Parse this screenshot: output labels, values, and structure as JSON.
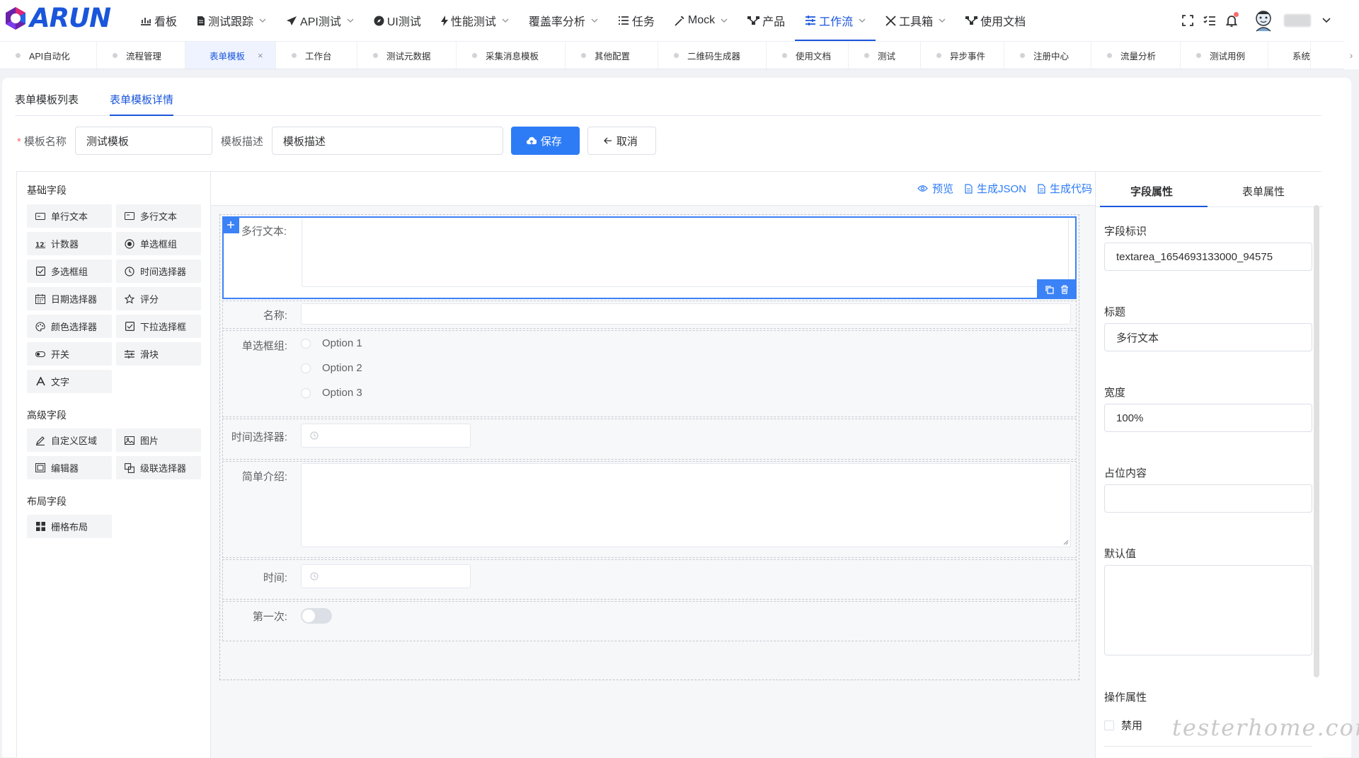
{
  "app": {
    "logo_text": "ARUN"
  },
  "menu": [
    {
      "label": "看板",
      "icon": "chart-icon",
      "dropdown": false
    },
    {
      "label": "测试跟踪",
      "icon": "document-icon",
      "dropdown": true
    },
    {
      "label": "API测试",
      "icon": "send-icon",
      "dropdown": true
    },
    {
      "label": "UI测试",
      "icon": "compass-icon",
      "dropdown": false
    },
    {
      "label": "性能测试",
      "icon": "lightning-icon",
      "dropdown": true
    },
    {
      "label": "覆盖率分析",
      "icon": "",
      "dropdown": true
    },
    {
      "label": "任务",
      "icon": "list-icon",
      "dropdown": false
    },
    {
      "label": "Mock",
      "icon": "wand-icon",
      "dropdown": true
    },
    {
      "label": "产品",
      "icon": "network-icon",
      "dropdown": false
    },
    {
      "label": "工作流",
      "icon": "sliders-icon",
      "dropdown": true,
      "active": true
    },
    {
      "label": "工具箱",
      "icon": "tools-icon",
      "dropdown": true
    },
    {
      "label": "使用文档",
      "icon": "network-icon",
      "dropdown": false
    }
  ],
  "tabs": [
    {
      "label": "API自动化"
    },
    {
      "label": "流程管理"
    },
    {
      "label": "表单模板",
      "active": true,
      "closable": true
    },
    {
      "label": "工作台"
    },
    {
      "label": "测试元数据"
    },
    {
      "label": "采集消息模板"
    },
    {
      "label": "其他配置"
    },
    {
      "label": "二维码生成器"
    },
    {
      "label": "使用文档"
    },
    {
      "label": "测试"
    },
    {
      "label": "异步事件"
    },
    {
      "label": "注册中心"
    },
    {
      "label": "流量分析"
    },
    {
      "label": "测试用例"
    },
    {
      "label": "系统"
    }
  ],
  "tab_close_glyph": "×",
  "subtabs": {
    "list": "表单模板列表",
    "detail": "表单模板详情"
  },
  "form": {
    "name_required_mark": "*",
    "name_label": "模板名称",
    "name_value": "测试模板",
    "desc_label": "模板描述",
    "desc_placeholder": "模板描述",
    "save_label": "保存",
    "cancel_label": "取消"
  },
  "left_panel": {
    "basic_title": "基础字段",
    "basic_fields": [
      {
        "label": "单行文本",
        "icon": "input-icon"
      },
      {
        "label": "多行文本",
        "icon": "textarea-icon"
      },
      {
        "label": "计数器",
        "icon": "counter-icon"
      },
      {
        "label": "单选框组",
        "icon": "radio-icon"
      },
      {
        "label": "多选框组",
        "icon": "checkbox-icon"
      },
      {
        "label": "时间选择器",
        "icon": "clock-icon"
      },
      {
        "label": "日期选择器",
        "icon": "calendar-icon"
      },
      {
        "label": "评分",
        "icon": "star-icon"
      },
      {
        "label": "颜色选择器",
        "icon": "palette-icon"
      },
      {
        "label": "下拉选择框",
        "icon": "select-icon"
      },
      {
        "label": "开关",
        "icon": "switch-icon"
      },
      {
        "label": "滑块",
        "icon": "slider-icon"
      },
      {
        "label": "文字",
        "icon": "text-icon"
      }
    ],
    "advanced_title": "高级字段",
    "advanced_fields": [
      {
        "label": "自定义区域",
        "icon": "edit-icon"
      },
      {
        "label": "图片",
        "icon": "image-icon"
      },
      {
        "label": "编辑器",
        "icon": "editor-icon"
      },
      {
        "label": "级联选择器",
        "icon": "cascader-icon"
      }
    ],
    "layout_title": "布局字段",
    "layout_fields": [
      {
        "label": "栅格布局",
        "icon": "grid-icon"
      }
    ]
  },
  "toolbar": {
    "preview": "预览",
    "json": "生成JSON",
    "code": "生成代码"
  },
  "canvas": {
    "textarea_label": "多行文本:",
    "name_label": "名称:",
    "radio_label": "单选框组:",
    "radio_options": [
      "Option 1",
      "Option 2",
      "Option 3"
    ],
    "time_label": "时间选择器:",
    "intro_label": "简单介绍:",
    "time2_label": "时间:",
    "first_label": "第一次:",
    "first_toggle_on": false
  },
  "right_panel": {
    "tab_field": "字段属性",
    "tab_form": "表单属性",
    "id_label": "字段标识",
    "id_value": "textarea_1654693133000_94575",
    "title_label": "标题",
    "title_value": "多行文本",
    "width_label": "宽度",
    "width_value": "100%",
    "placeholder_label": "占位内容",
    "placeholder_value": "",
    "default_label": "默认值",
    "default_value": "",
    "ops_label": "操作属性",
    "disabled_label": "禁用"
  },
  "watermark": "testerhome.com",
  "colors": {
    "primary": "#1a56db",
    "button": "#2d7cf6",
    "selected_border": "#3b82f6",
    "danger": "#f56c6c"
  }
}
